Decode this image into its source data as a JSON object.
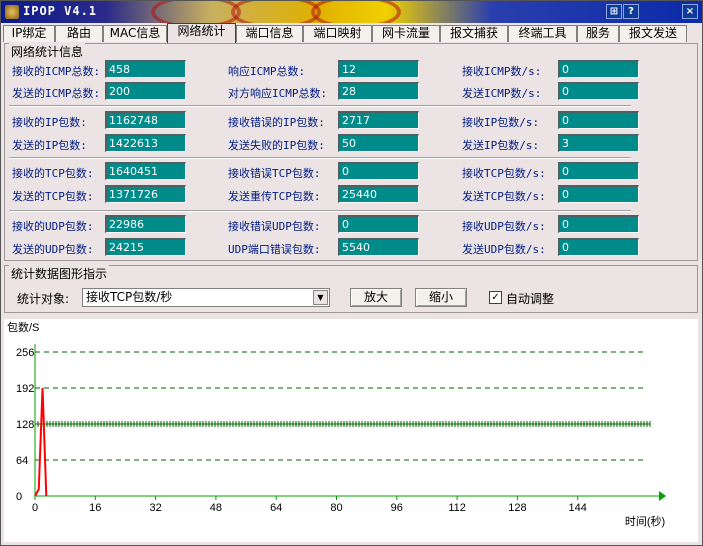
{
  "window": {
    "title": "IPOP V4.1",
    "buttons": {
      "restore": "⊞",
      "help": "?",
      "close": "×"
    }
  },
  "tabs": [
    "IP绑定",
    "路由",
    "MAC信息",
    "网络统计",
    "端口信息",
    "端口映射",
    "网卡流量",
    "报文捕获",
    "终端工具",
    "服务",
    "报文发送"
  ],
  "active_tab": "网络统计",
  "stats": {
    "title": "网络统计信息",
    "icmp": [
      {
        "label": "接收的ICMP总数:",
        "value": "458"
      },
      {
        "label": "响应ICMP总数:",
        "value": "12"
      },
      {
        "label": "接收ICMP数/s:",
        "value": "0"
      },
      {
        "label": "发送的ICMP总数:",
        "value": "200"
      },
      {
        "label": "对方响应ICMP总数:",
        "value": "28"
      },
      {
        "label": "发送ICMP数/s:",
        "value": "0"
      }
    ],
    "ip": [
      {
        "label": "接收的IP包数:",
        "value": "1162748"
      },
      {
        "label": "接收错误的IP包数:",
        "value": "2717"
      },
      {
        "label": "接收IP包数/s:",
        "value": "0"
      },
      {
        "label": "发送的IP包数:",
        "value": "1422613"
      },
      {
        "label": "发送失败的IP包数:",
        "value": "50"
      },
      {
        "label": "发送IP包数/s:",
        "value": "3"
      }
    ],
    "tcp": [
      {
        "label": "接收的TCP包数:",
        "value": "1640451"
      },
      {
        "label": "接收错误TCP包数:",
        "value": "0"
      },
      {
        "label": "接收TCP包数/s:",
        "value": "0"
      },
      {
        "label": "发送的TCP包数:",
        "value": "1371726"
      },
      {
        "label": "发送重传TCP包数:",
        "value": "25440"
      },
      {
        "label": "发送TCP包数/s:",
        "value": "0"
      }
    ],
    "udp": [
      {
        "label": "接收的UDP包数:",
        "value": "22986"
      },
      {
        "label": "接收错误UDP包数:",
        "value": "0"
      },
      {
        "label": "接收UDP包数/s:",
        "value": "0"
      },
      {
        "label": "发送的UDP包数:",
        "value": "24215"
      },
      {
        "label": "UDP端口错误包数:",
        "value": "5540"
      },
      {
        "label": "发送UDP包数/s:",
        "value": "0"
      }
    ]
  },
  "graph_controls": {
    "title": "统计数据图形指示",
    "object_label": "统计对象:",
    "selected": "接收TCP包数/秒",
    "zoom_in": "放大",
    "zoom_out": "缩小",
    "auto_adjust_label": "自动调整",
    "auto_adjust_checked": true
  },
  "chart_data": {
    "type": "line",
    "ylabel": "包数/S",
    "xlabel": "时间(秒)",
    "y_ticks": [
      "256",
      "192",
      "128",
      "64",
      "0"
    ],
    "x_ticks": [
      "0",
      "16",
      "32",
      "48",
      "64",
      "80",
      "96",
      "112",
      "128",
      "144"
    ],
    "ylim": [
      0,
      256
    ],
    "xlim": [
      0,
      160
    ],
    "grid": true,
    "reference_line": {
      "value": 128,
      "color": "#006400"
    },
    "series": [
      {
        "x": [
          0,
          1,
          2,
          3
        ],
        "values": [
          0,
          12,
          192,
          0
        ],
        "color": "#ff0000"
      }
    ],
    "colors": {
      "axis": "#00a000",
      "grid": "#006400",
      "series": "#ff0000"
    }
  }
}
